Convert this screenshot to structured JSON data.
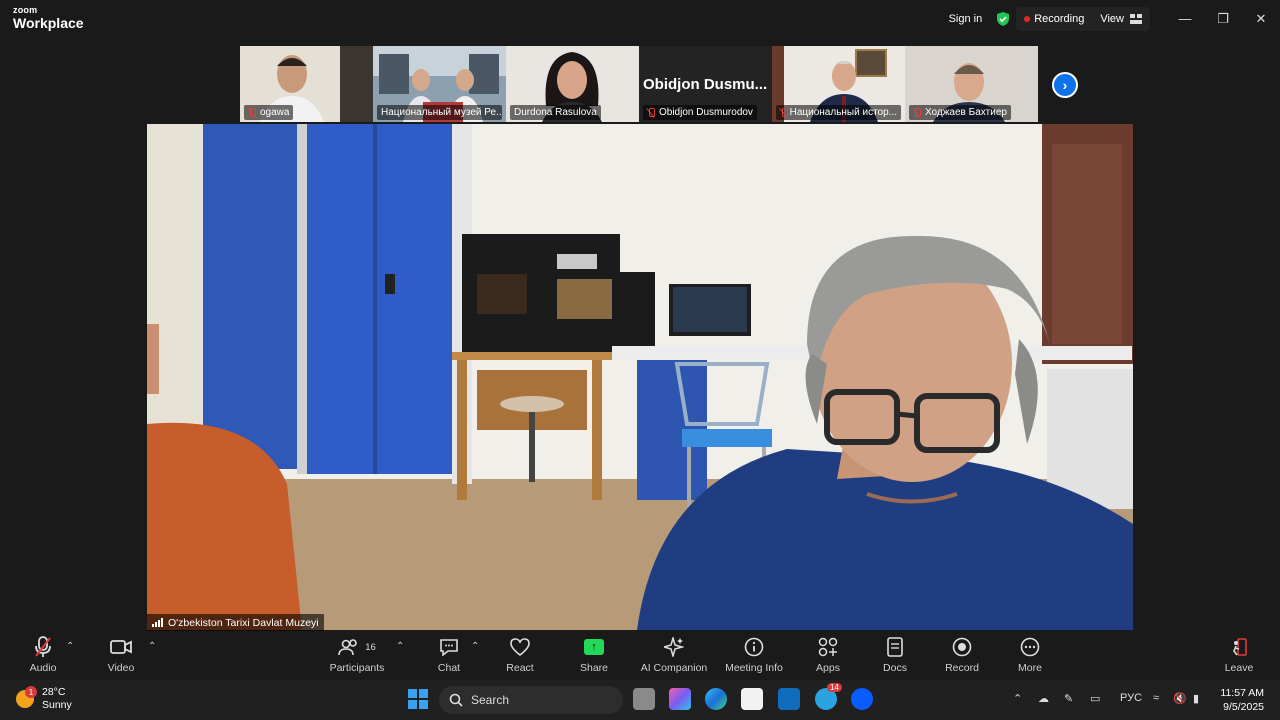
{
  "app": {
    "logo_small": "zoom",
    "logo_big": "Workplace"
  },
  "titlebar": {
    "sign_in": "Sign in",
    "recording": "Recording",
    "view": "View"
  },
  "thumbnails": [
    {
      "name": "ogawa"
    },
    {
      "name": "Национальный музей Ре..."
    },
    {
      "name": "Durdona Rasulova"
    },
    {
      "name": "Obidjon Dusmurodov",
      "display": "Obidjon  Dusmu..."
    },
    {
      "name": "Национальный истор..."
    },
    {
      "name": "Ходжаев Бахтиер"
    }
  ],
  "speaker": {
    "name": "O'zbekiston Tarixi Davlat Muzeyi"
  },
  "toolbar": {
    "audio": "Audio",
    "video": "Video",
    "participants": "Participants",
    "participants_count": "16",
    "chat": "Chat",
    "react": "React",
    "share": "Share",
    "ai_companion": "AI Companion",
    "meeting_info": "Meeting Info",
    "apps": "Apps",
    "docs": "Docs",
    "record": "Record",
    "more": "More",
    "leave": "Leave"
  },
  "taskbar": {
    "temperature": "28°C",
    "weather": "Sunny",
    "weather_badge": "1",
    "search": "Search",
    "telegram_badge": "14",
    "language": "РУС",
    "time": "11:57 AM",
    "date": "9/5/2025"
  }
}
